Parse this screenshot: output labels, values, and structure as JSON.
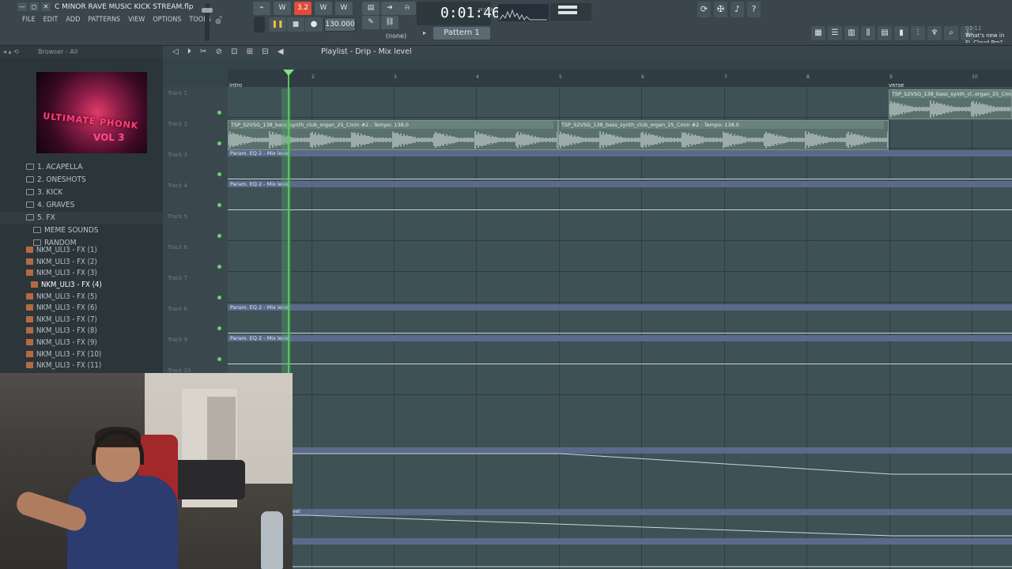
{
  "window": {
    "project_title": "C MINOR RAVE MUSIC KICK STREAM.flp",
    "controls": [
      "—",
      "◻",
      "✕"
    ]
  },
  "menu": [
    "FILE",
    "EDIT",
    "ADD",
    "PATTERNS",
    "VIEW",
    "OPTIONS",
    "TOOLS",
    "?"
  ],
  "transport": {
    "tempo": "130.000",
    "time": "0:01:46",
    "time_label": "M:S:CS",
    "snap": "(none)",
    "pattern": "Pattern 1",
    "top_buttons": [
      "⌁",
      "W",
      "3.2",
      "W",
      "W"
    ]
  },
  "news": {
    "date": "03-11",
    "text": "What's new in FL Cloud Pro?"
  },
  "browser": {
    "header": "Browser - All",
    "album_text": "ULTIMATE PHONK",
    "album_vol": "VOL 3",
    "folders": [
      {
        "label": "1. ACAPELLA",
        "indent": 0
      },
      {
        "label": "2. ONESHOTS",
        "indent": 0
      },
      {
        "label": "3. KICK",
        "indent": 0
      },
      {
        "label": "4. GRAVES",
        "indent": 0
      },
      {
        "label": "5. FX",
        "indent": 0
      },
      {
        "label": "MEME SOUNDS",
        "indent": 1
      },
      {
        "label": "RANDOM",
        "indent": 1
      }
    ],
    "files": [
      "NKM_ULI3 - FX (1)",
      "NKM_ULI3 - FX (2)",
      "NKM_ULI3 - FX (3)",
      "NKM_ULI3 - FX (4)",
      "NKM_ULI3 - FX (5)",
      "NKM_ULI3 - FX (6)",
      "NKM_ULI3 - FX (7)",
      "NKM_ULI3 - FX (8)",
      "NKM_ULI3 - FX (9)",
      "NKM_ULI3 - FX (10)",
      "NKM_ULI3 - FX (11)"
    ],
    "selected_file_index": 3
  },
  "playlist": {
    "title": "Playlist - Drip - Mix level",
    "bar_numbers": [
      "2",
      "3",
      "4",
      "5",
      "6",
      "7",
      "8",
      "9",
      "10"
    ],
    "markers": [
      {
        "label": "intro"
      },
      {
        "label": "verse"
      }
    ],
    "tracks": [
      "Track 1",
      "Track 2",
      "Track 3",
      "Track 4",
      "Track 5",
      "Track 6",
      "Track 7",
      "Track 8",
      "Track 9",
      "Track 10"
    ],
    "audio_clip_label": "TSP_S2VSG_138_bass_synth_club_organ_25_Cmin #2 - Tempo: 138.0",
    "audio_clip_label_short": "TSP_S2VSG_138_bass_synth_cl..organ_25_Cmin",
    "automation_label": "Param. EQ 2 - Mix level",
    "automation_label_partial": "vel"
  },
  "colors": {
    "accent_green": "#5bd45b",
    "clip_audio": "#59706c",
    "clip_automation": "#5b6a8a",
    "record_red": "#e04a3a"
  }
}
